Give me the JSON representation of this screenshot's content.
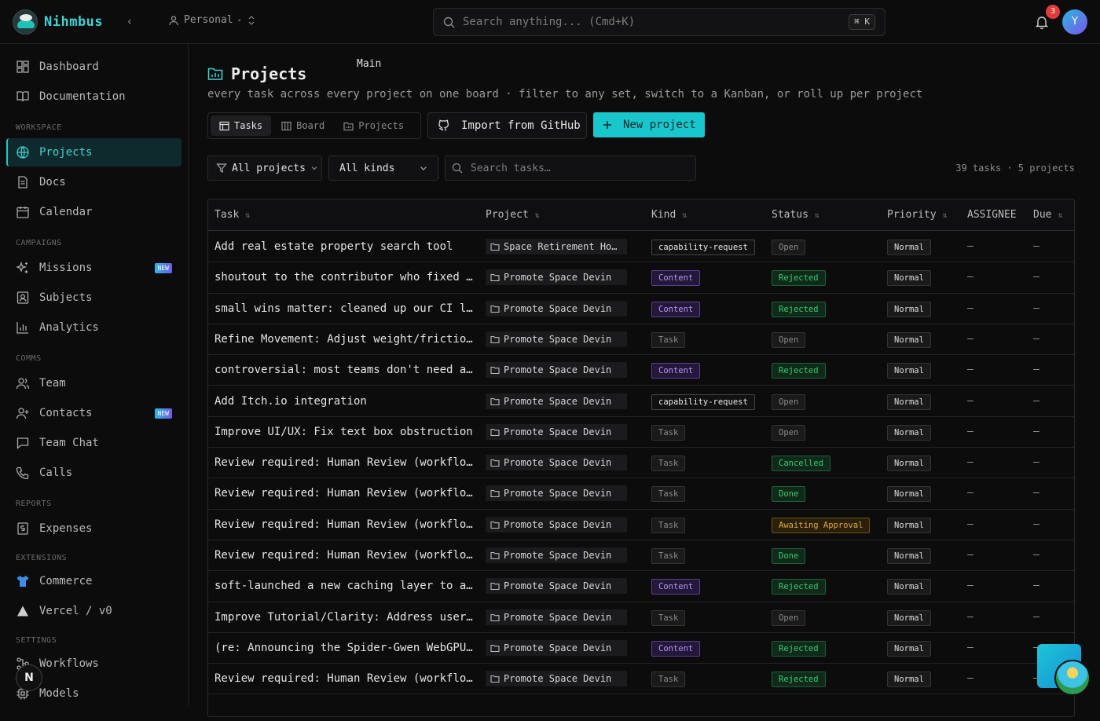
{
  "app": {
    "name": "Nihmbus"
  },
  "context": {
    "workspace": "Personal",
    "branch": "Main"
  },
  "search": {
    "placeholder": "Search anything... (Cmd+K)",
    "shortcut": "⌘ K"
  },
  "notifications": {
    "count": "3"
  },
  "user": {
    "initial": "Y"
  },
  "sidebar": {
    "top": [
      {
        "label": "Dashboard",
        "icon": "dashboard-icon"
      },
      {
        "label": "Documentation",
        "icon": "book-icon"
      }
    ],
    "sections": {
      "workspace": "WORKSPACE",
      "campaigns": "CAMPAIGNS",
      "comms": "COMMS",
      "reports": "REPORTS",
      "extensions": "EXTENSIONS",
      "settings": "SETTINGS"
    },
    "items": {
      "projects": "Projects",
      "docs": "Docs",
      "calendar": "Calendar",
      "missions": "Missions",
      "subjects": "Subjects",
      "analytics": "Analytics",
      "team": "Team",
      "contacts": "Contacts",
      "team_chat": "Team Chat",
      "calls": "Calls",
      "expenses": "Expenses",
      "commerce": "Commerce",
      "vercel": "Vercel / v0",
      "workflows": "Workflows",
      "models": "Models"
    },
    "new_tag": "NEW",
    "bottom_initial": "N"
  },
  "page": {
    "title": "Projects",
    "subtitle": "every task across every project on one board · filter to any set, switch to a Kanban, or roll up per project",
    "views": [
      "Tasks",
      "Board",
      "Projects"
    ],
    "import_label": "Import from GitHub",
    "new_label": "New project",
    "filters": {
      "project": "All projects",
      "kind": "All kinds",
      "search_placeholder": "Search tasks…"
    },
    "counts": "39 tasks · 5 projects"
  },
  "table": {
    "headers": {
      "task": "Task",
      "project": "Project",
      "kind": "Kind",
      "status": "Status",
      "priority": "Priority",
      "assignee": "ASSIGNEE",
      "due": "Due"
    },
    "rows": [
      {
        "task": "Add real estate property search tool",
        "project": "Space Retirement Hom…",
        "kind": "capability-request",
        "status": "Open",
        "priority": "Normal",
        "assignee": "—",
        "due": "—"
      },
      {
        "task": "shoutout to the contributor who fixed …",
        "project": "Promote Space Devin",
        "kind": "Content",
        "status": "Rejected",
        "priority": "Normal",
        "assignee": "—",
        "due": "—"
      },
      {
        "task": "small wins matter: cleaned up our CI l…",
        "project": "Promote Space Devin",
        "kind": "Content",
        "status": "Rejected",
        "priority": "Normal",
        "assignee": "—",
        "due": "—"
      },
      {
        "task": "Refine Movement: Adjust weight/frictio…",
        "project": "Promote Space Devin",
        "kind": "Task",
        "status": "Open",
        "priority": "Normal",
        "assignee": "—",
        "due": "—"
      },
      {
        "task": "controversial: most teams don't need a…",
        "project": "Promote Space Devin",
        "kind": "Content",
        "status": "Rejected",
        "priority": "Normal",
        "assignee": "—",
        "due": "—"
      },
      {
        "task": "Add Itch.io integration",
        "project": "Promote Space Devin",
        "kind": "capability-request",
        "status": "Open",
        "priority": "Normal",
        "assignee": "—",
        "due": "—"
      },
      {
        "task": "Improve UI/UX: Fix text box obstruction",
        "project": "Promote Space Devin",
        "kind": "Task",
        "status": "Open",
        "priority": "Normal",
        "assignee": "—",
        "due": "—"
      },
      {
        "task": "Review required: Human Review (workflo…",
        "project": "Promote Space Devin",
        "kind": "Task",
        "status": "Cancelled",
        "priority": "Normal",
        "assignee": "—",
        "due": "—"
      },
      {
        "task": "Review required: Human Review (workflo…",
        "project": "Promote Space Devin",
        "kind": "Task",
        "status": "Done",
        "priority": "Normal",
        "assignee": "—",
        "due": "—"
      },
      {
        "task": "Review required: Human Review (workflo…",
        "project": "Promote Space Devin",
        "kind": "Task",
        "status": "Awaiting Approval",
        "priority": "Normal",
        "assignee": "—",
        "due": "—"
      },
      {
        "task": "Review required: Human Review (workflo…",
        "project": "Promote Space Devin",
        "kind": "Task",
        "status": "Done",
        "priority": "Normal",
        "assignee": "—",
        "due": "—"
      },
      {
        "task": "soft-launched a new caching layer to a…",
        "project": "Promote Space Devin",
        "kind": "Content",
        "status": "Rejected",
        "priority": "Normal",
        "assignee": "—",
        "due": "—"
      },
      {
        "task": "Improve Tutorial/Clarity: Address user…",
        "project": "Promote Space Devin",
        "kind": "Task",
        "status": "Open",
        "priority": "Normal",
        "assignee": "—",
        "due": "—"
      },
      {
        "task": "(re: Announcing the Spider-Gwen WebGPU…",
        "project": "Promote Space Devin",
        "kind": "Content",
        "status": "Rejected",
        "priority": "Normal",
        "assignee": "—",
        "due": "—"
      },
      {
        "task": "Review required: Human Review (workflo…",
        "project": "Promote Space Devin",
        "kind": "Task",
        "status": "Rejected",
        "priority": "Normal",
        "assignee": "—",
        "due": "—"
      }
    ]
  }
}
